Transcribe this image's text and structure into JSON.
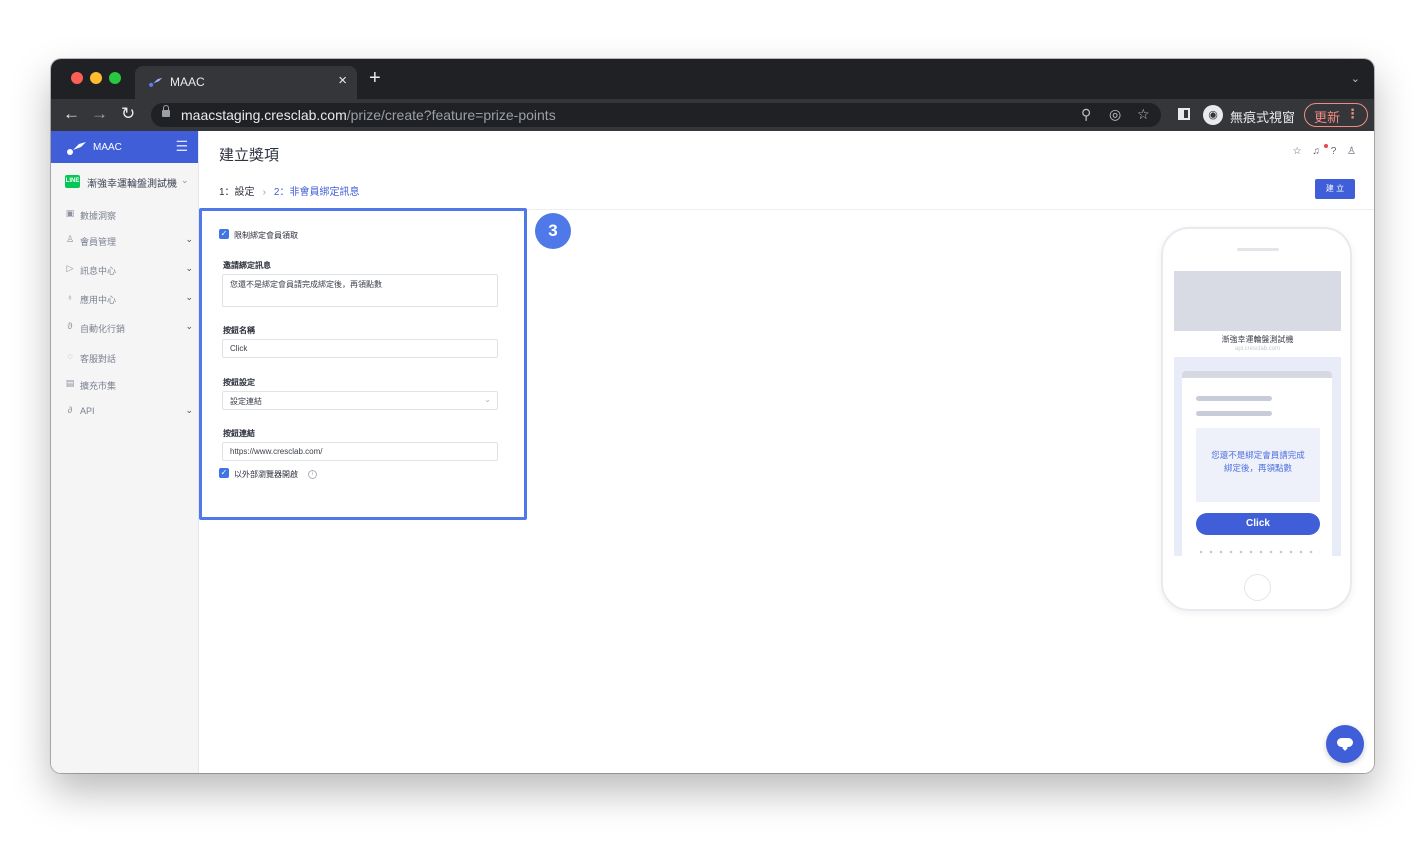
{
  "browser": {
    "tab_title": "MAAC",
    "tab_close": "×",
    "new_tab": "+",
    "tab_menu": "⌄",
    "url_host": "maacstaging.cresclab.com",
    "url_path": "/prize/create?feature=prize-points",
    "incognito_label": "無痕式視窗",
    "update_label": "更新",
    "menu_glyph": "⋮",
    "icons": [
      "back-icon",
      "forward-icon",
      "reload-icon",
      "lock-icon",
      "zoom-icon",
      "tracking-blocked-icon",
      "bookmark-star-icon",
      "side-panel-icon",
      "incognito-icon",
      "more-icon"
    ]
  },
  "sidebar": {
    "brand": "MAAC",
    "account": "漸強幸運輪盤測試機",
    "items": [
      {
        "label": "數據洞察",
        "icon": "chart-icon",
        "has_caret": false
      },
      {
        "label": "會員管理",
        "icon": "person-icon",
        "has_caret": true
      },
      {
        "label": "訊息中心",
        "icon": "send-icon",
        "has_caret": true
      },
      {
        "label": "應用中心",
        "icon": "bulb-icon",
        "has_caret": true
      },
      {
        "label": "自動化行銷",
        "icon": "automation-icon",
        "has_caret": true
      },
      {
        "label": "客服對話",
        "icon": "chat-bubble-icon",
        "has_caret": false
      },
      {
        "label": "擴充市集",
        "icon": "store-icon",
        "has_caret": false
      },
      {
        "label": "API",
        "icon": "link-icon",
        "has_caret": true
      }
    ]
  },
  "header": {
    "title": "建立獎項",
    "create_button": "建 立"
  },
  "breadcrumb": {
    "step1": "1：設定",
    "separator": "›",
    "step2": "2：非會員綁定訊息"
  },
  "form": {
    "restrict_label": "限制綁定會員領取",
    "invite_label": "邀請綁定訊息",
    "invite_value": "您還不是綁定會員請完成綁定後，再領點數",
    "button_name_label": "按鈕名稱",
    "button_name_value": "Click",
    "button_setting_label": "按鈕設定",
    "button_setting_value": "設定連結",
    "button_link_label": "按鈕連結",
    "button_link_value": "https://www.cresclab.com/",
    "external_browser_label": "以外部瀏覽器開啟"
  },
  "step_marker": "3",
  "preview": {
    "account_name": "漸強幸運輪盤測試機",
    "url": "api.cresclab.com",
    "message": "您還不是綁定會員請完成綁定後，再領點數",
    "button": "Click"
  },
  "colors": {
    "brand": "#3f5ed8",
    "highlight": "#4f79e8",
    "line_green": "#06c755"
  }
}
